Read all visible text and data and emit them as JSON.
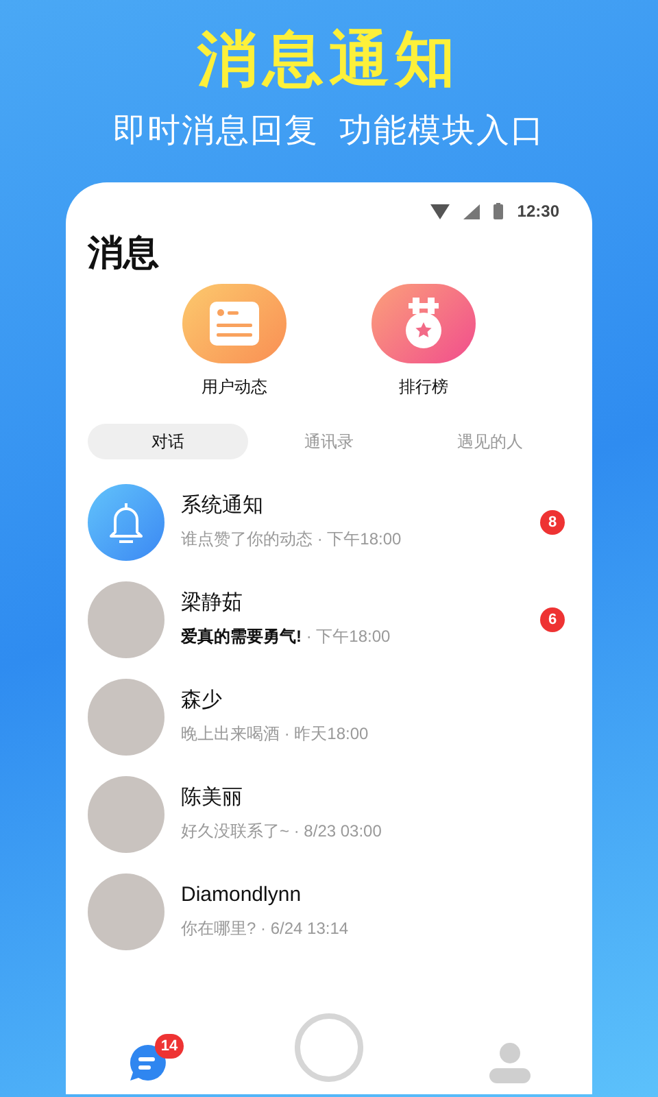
{
  "headline": "消息通知",
  "subtitle": "即时消息回复  功能模块入口",
  "status_bar": {
    "time": "12:30"
  },
  "title": "消息",
  "shortcuts": [
    {
      "kind": "feed",
      "label": "用户动态"
    },
    {
      "kind": "ranking",
      "label": "排行榜"
    }
  ],
  "tabs": [
    {
      "label": "对话",
      "selected": true
    },
    {
      "label": "通讯录",
      "selected": false
    },
    {
      "label": "遇见的人",
      "selected": false
    }
  ],
  "conversations": [
    {
      "kind": "system",
      "name": "系统通知",
      "preview": "谁点赞了你的动态",
      "time": "· 下午18:00",
      "highlighted": false,
      "badge": "8"
    },
    {
      "kind": "user",
      "name": "梁静茹",
      "preview": "爱真的需要勇气!",
      "time": "· 下午18:00",
      "highlighted": true,
      "badge": "6"
    },
    {
      "kind": "user",
      "name": "森少",
      "preview": "晚上出来喝酒",
      "time": "· 昨天18:00",
      "highlighted": false
    },
    {
      "kind": "user",
      "name": "陈美丽",
      "preview": "好久没联系了~",
      "time": "· 8/23 03:00",
      "highlighted": false
    },
    {
      "kind": "user",
      "name": "Diamondlynn",
      "preview": "你在哪里?",
      "time": "· 6/24 13:14",
      "highlighted": false
    }
  ],
  "bottom_nav": [
    {
      "kind": "chat",
      "selected": true,
      "badge": "14"
    },
    {
      "kind": "home",
      "selected": false
    },
    {
      "kind": "profile",
      "selected": false
    }
  ]
}
